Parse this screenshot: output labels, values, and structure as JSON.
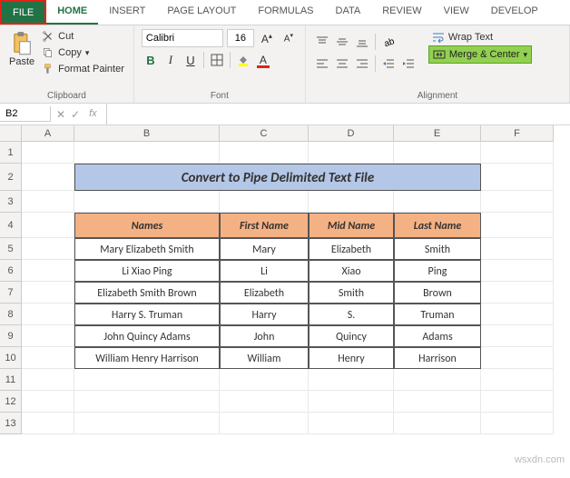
{
  "tabs": [
    "FILE",
    "HOME",
    "INSERT",
    "PAGE LAYOUT",
    "FORMULAS",
    "DATA",
    "REVIEW",
    "VIEW",
    "DEVELOP"
  ],
  "clipboard": {
    "paste": "Paste",
    "cut": "Cut",
    "copy": "Copy",
    "format_painter": "Format Painter",
    "label": "Clipboard"
  },
  "font": {
    "name": "Calibri",
    "size": "16",
    "label": "Font"
  },
  "alignment": {
    "wrap": "Wrap Text",
    "merge": "Merge & Center",
    "label": "Alignment"
  },
  "namebox": "B2",
  "columns": [
    "A",
    "B",
    "C",
    "D",
    "E",
    "F"
  ],
  "title": "Convert to Pipe Delimited Text File",
  "headers": {
    "names": "Names",
    "first": "First Name",
    "mid": "Mid Name",
    "last": "Last Name"
  },
  "rows": [
    {
      "name": "Mary Elizabeth Smith",
      "first": "Mary",
      "mid": "Elizabeth",
      "last": "Smith"
    },
    {
      "name": "Li Xiao Ping",
      "first": "Li",
      "mid": "Xiao",
      "last": "Ping"
    },
    {
      "name": "Elizabeth Smith Brown",
      "first": "Elizabeth",
      "mid": "Smith",
      "last": "Brown"
    },
    {
      "name": "Harry S. Truman",
      "first": "Harry",
      "mid": "S.",
      "last": "Truman"
    },
    {
      "name": "John Quincy Adams",
      "first": "John",
      "mid": "Quincy",
      "last": "Adams"
    },
    {
      "name": "William Henry Harrison",
      "first": "William",
      "mid": "Henry",
      "last": "Harrison"
    }
  ],
  "rownums": [
    "1",
    "2",
    "3",
    "4",
    "5",
    "6",
    "7",
    "8",
    "9",
    "10",
    "11",
    "12",
    "13"
  ],
  "watermark": "wsxdn.com"
}
